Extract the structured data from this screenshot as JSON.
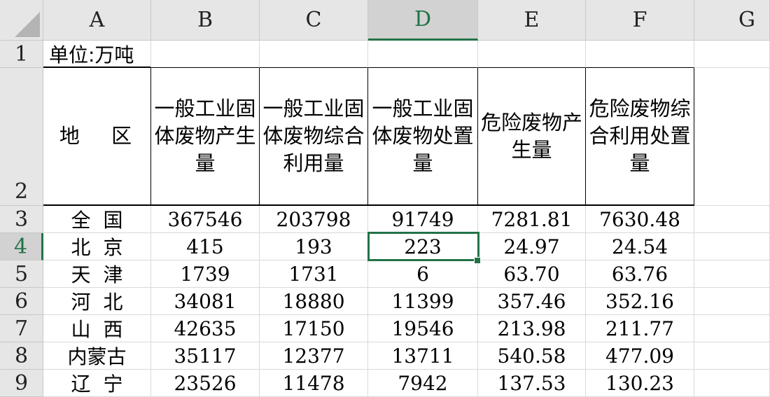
{
  "columns": [
    "A",
    "B",
    "C",
    "D",
    "E",
    "F",
    "G"
  ],
  "selected_column": "D",
  "rows": [
    "1",
    "2",
    "3",
    "4",
    "5",
    "6",
    "7",
    "8",
    "9"
  ],
  "selected_row": "4",
  "unit_label": "单位:万吨",
  "headers": {
    "region": "地 区",
    "b": "一般工业固体废物产生量",
    "c": "一般工业固体废物综合利用量",
    "d": "一般工业固体废物处置量",
    "e": "危险废物产生量",
    "f": "危险废物综合利用处置量"
  },
  "data_rows": [
    {
      "region": "全国",
      "b": "367546",
      "c": "203798",
      "d": "91749",
      "e": "7281.81",
      "f": "7630.48"
    },
    {
      "region": "北京",
      "b": "415",
      "c": "193",
      "d": "223",
      "e": "24.97",
      "f": "24.54"
    },
    {
      "region": "天津",
      "b": "1739",
      "c": "1731",
      "d": "6",
      "e": "63.70",
      "f": "63.76"
    },
    {
      "region": "河北",
      "b": "34081",
      "c": "18880",
      "d": "11399",
      "e": "357.46",
      "f": "352.16"
    },
    {
      "region": "山西",
      "b": "42635",
      "c": "17150",
      "d": "19546",
      "e": "213.98",
      "f": "211.77"
    },
    {
      "region": "内蒙古",
      "b": "35117",
      "c": "12377",
      "d": "13711",
      "e": "540.58",
      "f": "477.09"
    },
    {
      "region": "辽宁",
      "b": "23526",
      "c": "11478",
      "d": "7942",
      "e": "137.53",
      "f": "130.23"
    }
  ],
  "colors": {
    "accent": "#217346",
    "header_bg": "#e6e6e6",
    "selected_header_bg": "#d2d2d2"
  }
}
